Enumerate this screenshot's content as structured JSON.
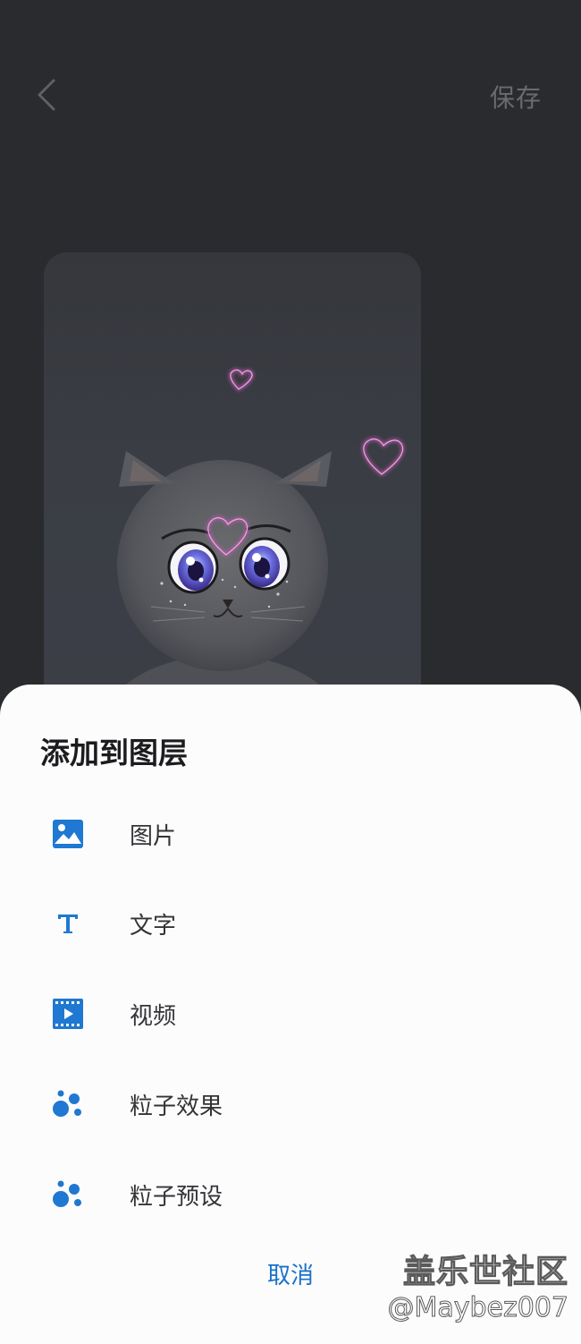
{
  "header": {
    "save_label": "保存"
  },
  "sheet": {
    "title": "添加到图层",
    "items": [
      {
        "label": "图片",
        "icon": "image-icon"
      },
      {
        "label": "文字",
        "icon": "text-icon"
      },
      {
        "label": "视频",
        "icon": "video-icon"
      },
      {
        "label": "粒子效果",
        "icon": "particle-icon"
      },
      {
        "label": "粒子预设",
        "icon": "particle-icon"
      }
    ],
    "cancel_label": "取消"
  },
  "watermark": {
    "title": "盖乐世社区",
    "user": "@Maybez007"
  },
  "colors": {
    "accent": "#1a72c9",
    "background": "#2a2b2e",
    "sheet": "#fcfcfd"
  }
}
